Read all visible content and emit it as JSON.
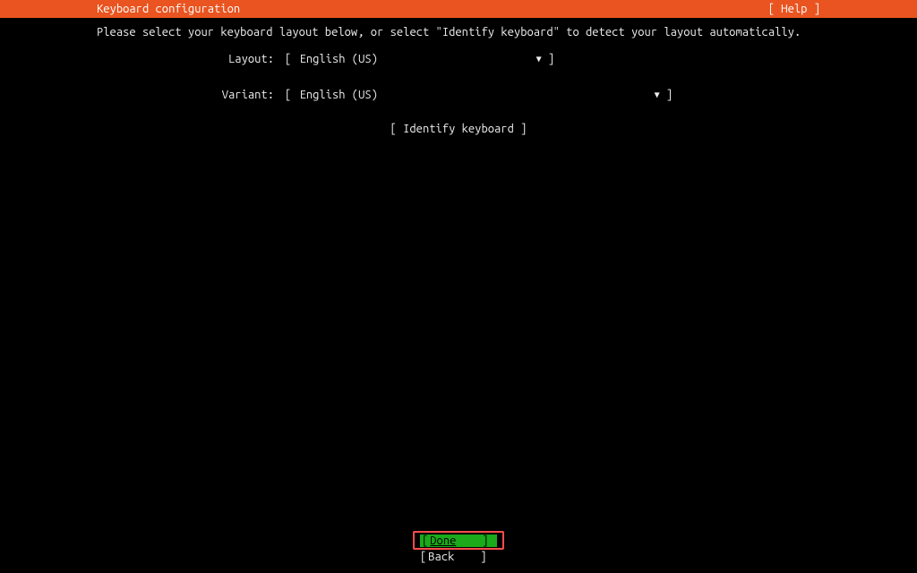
{
  "header": {
    "title": "Keyboard configuration",
    "help_label": "[ Help ]"
  },
  "main": {
    "instruction": "Please select your keyboard layout below, or select \"Identify keyboard\" to detect your layout automatically.",
    "layout_label": "Layout:",
    "layout_value": "English (US)",
    "variant_label": "Variant:",
    "variant_value": "English (US)",
    "identify_label": "[ Identify keyboard ]"
  },
  "footer": {
    "done_label": "Done",
    "back_label": "Back"
  }
}
